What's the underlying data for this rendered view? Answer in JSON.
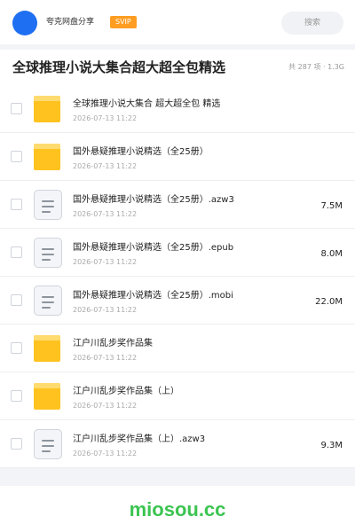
{
  "header": {
    "user_name": "夸克网盘分享",
    "badge": "SVIP",
    "search_label": "搜索"
  },
  "title_bar": {
    "title": "全球推理小说大集合超大超全包精选",
    "meta": "共 287 项 · 1.3G"
  },
  "files": [
    {
      "type": "folder",
      "icon": "folder-icon",
      "name": "全球推理小说大集合 超大超全包 精选",
      "date": "2026-07-13 11:22",
      "size": ""
    },
    {
      "type": "folder",
      "icon": "folder-icon",
      "name": "国外悬疑推理小说精选（全25册）",
      "date": "2026-07-13 11:22",
      "size": ""
    },
    {
      "type": "file",
      "icon": "document-icon",
      "name": "国外悬疑推理小说精选（全25册）.azw3",
      "date": "2026-07-13 11:22",
      "size": "7.5M"
    },
    {
      "type": "file",
      "icon": "document-icon",
      "name": "国外悬疑推理小说精选（全25册）.epub",
      "date": "2026-07-13 11:22",
      "size": "8.0M"
    },
    {
      "type": "file",
      "icon": "document-icon",
      "name": "国外悬疑推理小说精选（全25册）.mobi",
      "date": "2026-07-13 11:22",
      "size": "22.0M"
    },
    {
      "type": "folder",
      "icon": "folder-icon",
      "name": "江户川乱步奖作品集",
      "date": "2026-07-13 11:22",
      "size": ""
    },
    {
      "type": "folder",
      "icon": "folder-icon",
      "name": "江户川乱步奖作品集（上）",
      "date": "2026-07-13 11:22",
      "size": ""
    },
    {
      "type": "file",
      "icon": "document-icon",
      "name": "江户川乱步奖作品集（上）.azw3",
      "date": "2026-07-13 11:22",
      "size": "9.3M"
    }
  ],
  "footer": {
    "brand": "miosou.cc"
  },
  "colors": {
    "accent_blue": "#1e6ff2",
    "svip_orange": "#ff9d22",
    "folder_yellow": "#ffc21f",
    "brand_green": "#3cc451"
  }
}
